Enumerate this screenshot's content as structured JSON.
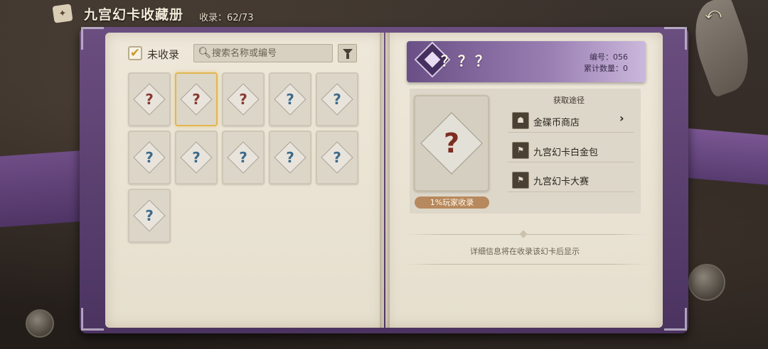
{
  "header": {
    "title": "九宫幻卡收藏册",
    "collect_label": "收录：62/73",
    "back_icon": "⤺"
  },
  "left_page": {
    "filter_checkbox": {
      "checked": true,
      "label": "未收录"
    },
    "search": {
      "placeholder": "搜索名称或编号"
    },
    "cards": [
      {
        "qcolor": "#8a3a32",
        "selected": false
      },
      {
        "qcolor": "#8a3a32",
        "selected": true
      },
      {
        "qcolor": "#8a3a32",
        "selected": false
      },
      {
        "qcolor": "#3e6b8a",
        "selected": false
      },
      {
        "qcolor": "#3e6b8a",
        "selected": false
      },
      {
        "qcolor": "#3e6b8a",
        "selected": false
      },
      {
        "qcolor": "#3e6b8a",
        "selected": false
      },
      {
        "qcolor": "#3e6b8a",
        "selected": false
      },
      {
        "qcolor": "#3e6b8a",
        "selected": false
      },
      {
        "qcolor": "#3e6b8a",
        "selected": false
      },
      {
        "qcolor": "#3e6b8a",
        "selected": false
      }
    ],
    "card_qmark": "?"
  },
  "right_page": {
    "card_name": "？？？",
    "number_label": "编号：056",
    "count_label": "累计数量：0",
    "big_card_qmark": "?",
    "collect_rate": "1%玩家收录",
    "source_title": "获取途径",
    "sources": [
      {
        "label": "金碟币商店",
        "icon": "shop-icon",
        "arrow": "›"
      },
      {
        "label": "九宫幻卡白金包",
        "icon": "card-pack-icon",
        "arrow": ""
      },
      {
        "label": "九宫幻卡大赛",
        "icon": "tournament-icon",
        "arrow": ""
      }
    ],
    "info_note": "详细信息将在收录该幻卡后显示"
  },
  "colors": {
    "accent_purple": "#6a4f86",
    "selected_gold": "#e3b652",
    "red_qmark": "#8a3a32",
    "blue_qmark": "#3e6b8a"
  }
}
